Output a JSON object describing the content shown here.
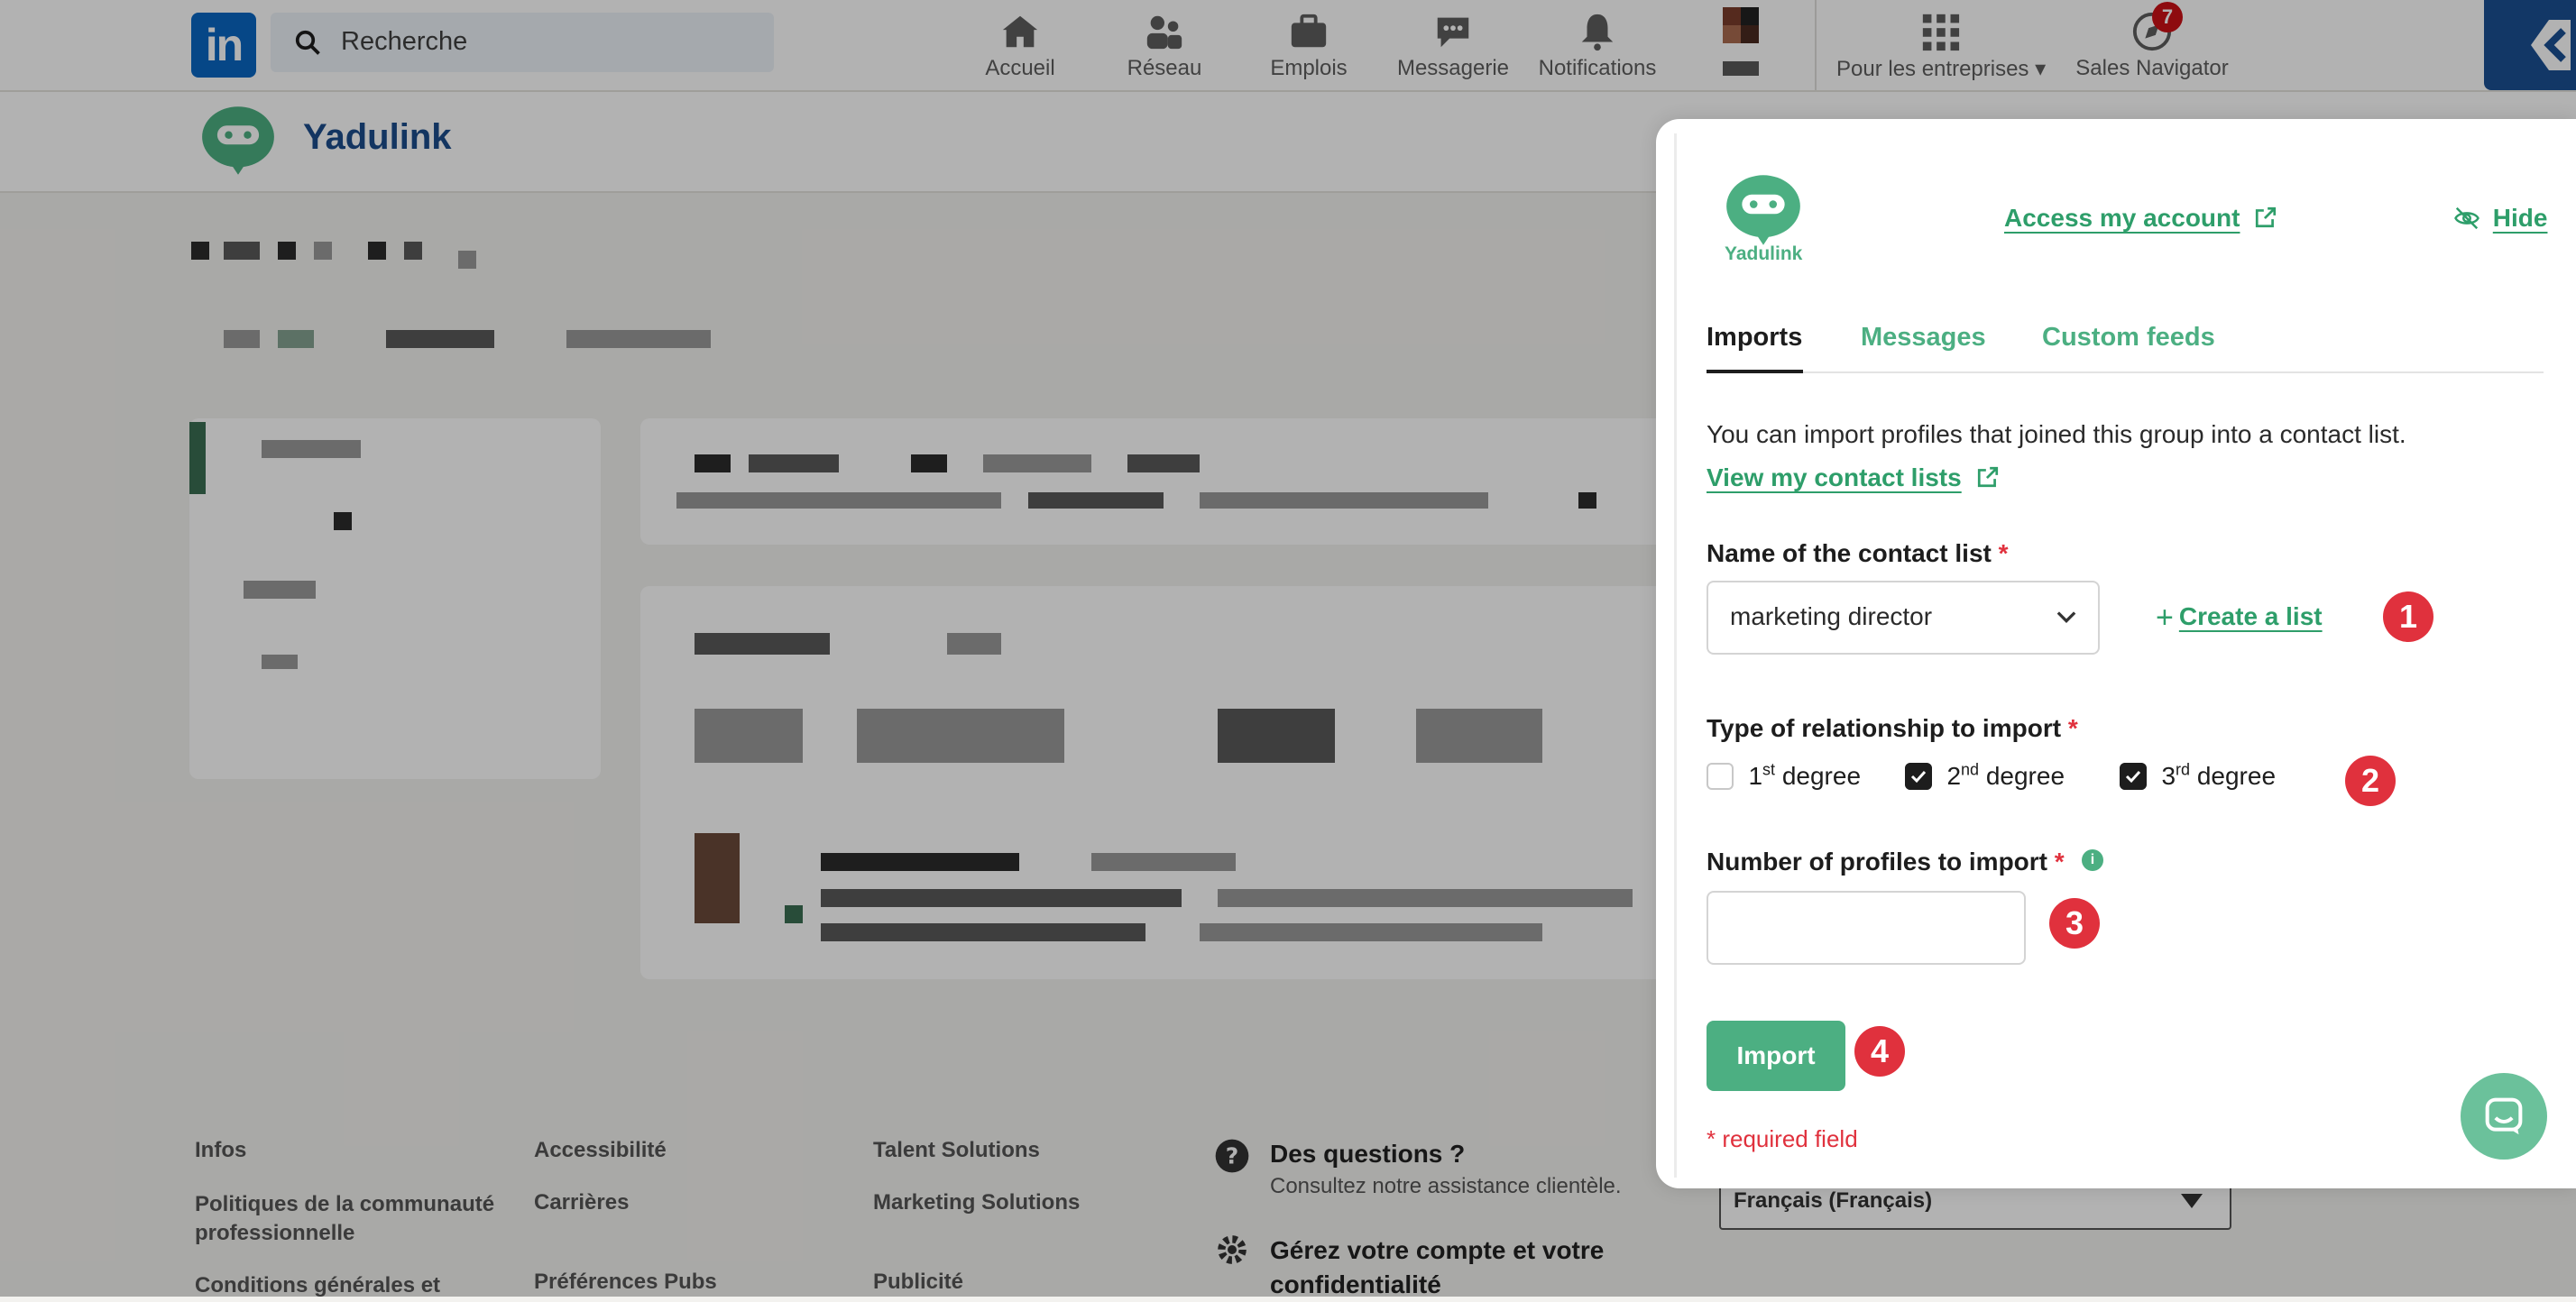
{
  "linkedin": {
    "logo": "in",
    "search_placeholder": "Recherche",
    "nav": [
      {
        "label": "Accueil",
        "icon": "home-icon"
      },
      {
        "label": "Réseau",
        "icon": "network-icon"
      },
      {
        "label": "Emplois",
        "icon": "briefcase-icon"
      },
      {
        "label": "Messagerie",
        "icon": "messaging-icon"
      },
      {
        "label": "Notifications",
        "icon": "bell-icon"
      }
    ],
    "business_label": "Pour les entreprises",
    "sales_navigator_label": "Sales Navigator",
    "sales_navigator_badge": "7"
  },
  "subheader": {
    "title": "Yadulink"
  },
  "footer": {
    "col1": [
      "Infos",
      "Politiques de la communauté professionnelle",
      "Conditions générales et"
    ],
    "col2": [
      "Accessibilité",
      "Carrières",
      "Préférences Pubs"
    ],
    "col3": [
      "Talent Solutions",
      "Marketing Solutions",
      "Publicité"
    ],
    "questions_title": "Des questions ?",
    "questions_sub": "Consultez notre assistance clientèle.",
    "manage_title": "Gérez votre compte et votre confidentialité",
    "language": "Français (Français)"
  },
  "panel": {
    "logo_text": "Yadulink",
    "access_account": "Access my account",
    "hide": "Hide",
    "tabs": [
      "Imports",
      "Messages",
      "Custom feeds"
    ],
    "description": "You can import profiles that joined this group into a contact list.",
    "view_lists": "View my contact lists",
    "list_label": "Name of the contact list",
    "required_mark": "*",
    "list_value": "marketing director",
    "create_list": "Create a list",
    "relationship_label": "Type of relationship to import",
    "degrees": [
      {
        "num": "1",
        "sup": "st",
        "text": " degree",
        "checked": false
      },
      {
        "num": "2",
        "sup": "nd",
        "text": " degree",
        "checked": true
      },
      {
        "num": "3",
        "sup": "rd",
        "text": " degree",
        "checked": true
      }
    ],
    "number_label": "Number of profiles to import",
    "number_value": "",
    "import_button": "Import",
    "required_note": "* required field",
    "step_badges": [
      "1",
      "2",
      "3",
      "4"
    ],
    "accent_color": "#4caf82",
    "error_color": "#e0313d"
  }
}
